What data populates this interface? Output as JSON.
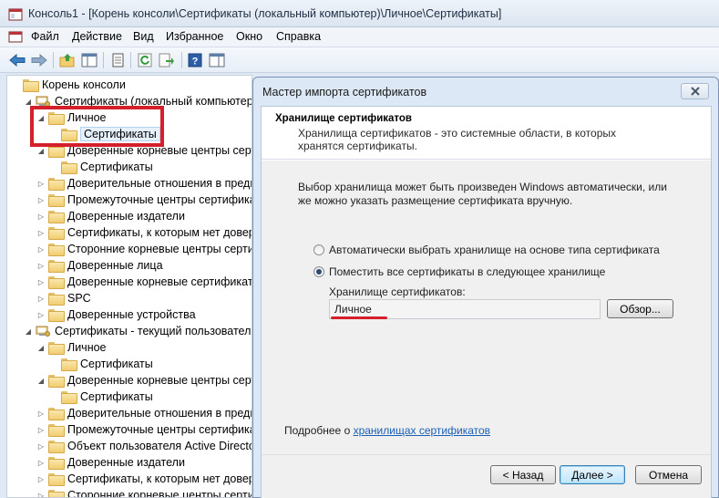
{
  "window": {
    "title": "Консоль1 - [Корень консоли\\Сертификаты (локальный компьютер)\\Личное\\Сертификаты]"
  },
  "menu": [
    "Файл",
    "Действие",
    "Вид",
    "Избранное",
    "Окно",
    "Справка"
  ],
  "toolbar": {
    "icons": [
      "back-arrow-icon",
      "forward-arrow-icon",
      "up-folder-icon",
      "show-hide-tree-icon",
      "properties-icon",
      "refresh-icon",
      "export-list-icon",
      "help-icon",
      "action-pane-icon"
    ]
  },
  "tree": {
    "items": [
      {
        "label": "Корень консоли",
        "arrow": "",
        "icon": "folder"
      },
      {
        "label": "Сертификаты (локальный компьютер)",
        "arrow": "◢",
        "icon": "computer"
      },
      {
        "label": "Личное",
        "arrow": "◢",
        "icon": "folder"
      },
      {
        "label": "Сертификаты",
        "arrow": "",
        "icon": "folder",
        "selected": true
      },
      {
        "label": "Доверенные корневые центры серти",
        "arrow": "◢",
        "icon": "folder"
      },
      {
        "label": "Сертификаты",
        "arrow": "",
        "icon": "folder"
      },
      {
        "label": "Доверительные отношения в предпр",
        "arrow": "▷",
        "icon": "folder"
      },
      {
        "label": "Промежуточные центры сертифика",
        "arrow": "▷",
        "icon": "folder"
      },
      {
        "label": "Доверенные издатели",
        "arrow": "▷",
        "icon": "folder"
      },
      {
        "label": "Сертификаты, к которым нет довери",
        "arrow": "▷",
        "icon": "folder"
      },
      {
        "label": "Сторонние корневые центры сертиф",
        "arrow": "▷",
        "icon": "folder"
      },
      {
        "label": "Доверенные лица",
        "arrow": "▷",
        "icon": "folder"
      },
      {
        "label": "Доверенные корневые сертификаты",
        "arrow": "▷",
        "icon": "folder"
      },
      {
        "label": "SPC",
        "arrow": "▷",
        "icon": "folder"
      },
      {
        "label": "Доверенные устройства",
        "arrow": "▷",
        "icon": "folder"
      },
      {
        "label": "Сертификаты - текущий пользователь",
        "arrow": "◢",
        "icon": "computer"
      },
      {
        "label": "Личное",
        "arrow": "◢",
        "icon": "folder"
      },
      {
        "label": "Сертификаты",
        "arrow": "",
        "icon": "folder"
      },
      {
        "label": "Доверенные корневые центры серти",
        "arrow": "◢",
        "icon": "folder"
      },
      {
        "label": "Сертификаты",
        "arrow": "",
        "icon": "folder"
      },
      {
        "label": "Доверительные отношения в предпр",
        "arrow": "▷",
        "icon": "folder"
      },
      {
        "label": "Промежуточные центры сертифика",
        "arrow": "▷",
        "icon": "folder"
      },
      {
        "label": "Объект пользователя Active Directory",
        "arrow": "▷",
        "icon": "folder"
      },
      {
        "label": "Доверенные издатели",
        "arrow": "▷",
        "icon": "folder"
      },
      {
        "label": "Сертификаты, к которым нет довери",
        "arrow": "▷",
        "icon": "folder"
      },
      {
        "label": "Сторонние корневые центры сертиф",
        "arrow": "▷",
        "icon": "folder"
      }
    ]
  },
  "dialog": {
    "title": "Мастер импорта сертификатов",
    "header_title": "Хранилище сертификатов",
    "header_desc": "Хранилища сертификатов - это системные области, в которых хранятся сертификаты.",
    "intro": "Выбор хранилища может быть произведен Windows автоматически, или же можно указать размещение сертификата вручную.",
    "radio_auto": "Автоматически выбрать хранилище на основе типа сертификата",
    "radio_manual": "Поместить все сертификаты в следующее хранилище",
    "selected_option": "manual",
    "store_label": "Хранилище сертификатов:",
    "store_value": "Личное",
    "browse_button": "Обзор...",
    "more_prefix": "Подробнее о ",
    "more_link": "хранилищах сертификатов",
    "back_button": "< Назад",
    "next_button": "Далее >",
    "cancel_button": "Отмена"
  },
  "colors": {
    "highlight": "#d4202a",
    "link": "#1b5fb5"
  }
}
